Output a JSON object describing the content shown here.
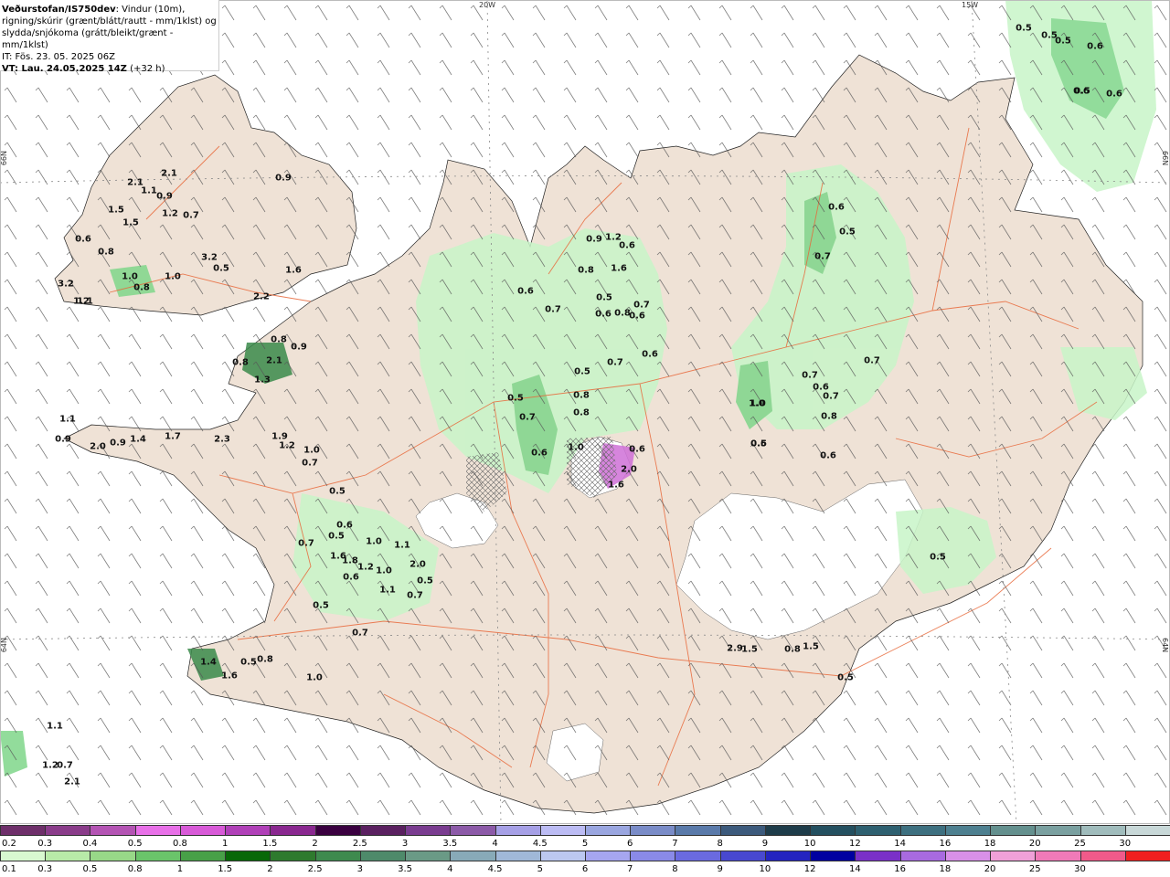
{
  "header": {
    "title": "Veðurstofan/IS750dev",
    "line1": ": Vindur (10m),",
    "line2": "rigning/skúrir (grænt/blátt/rautt - mm/1klst) og",
    "line3": "slydda/snjókoma (grátt/bleikt/grænt - mm/1klst)",
    "it": "IT: Fös. 23. 05. 2025 06Z",
    "vt": "VT: Lau. 24.05.2025 14Z",
    "vt_suffix": " (+32 h)"
  },
  "graticule": {
    "lon_top": [
      "20W",
      "15W"
    ],
    "lat_side": [
      "66N",
      "64N"
    ]
  },
  "colors": {
    "land": "#efe2d6",
    "sea": "#ffffff",
    "roads": "#e8683a",
    "precip_light": "#c8f5c8",
    "precip_mid": "#7fd68a",
    "precip_dark": "#3a8a4a",
    "snow_pink": "#d070d8",
    "glacier": "#ffffff"
  },
  "precip_labels": [
    "0.5",
    "0.5",
    "0.5",
    "0.6",
    "0.5",
    "0.6",
    "0.6",
    "0.9",
    "2.1",
    "2.1",
    "1.1",
    "0.9",
    "1.5",
    "1.2",
    "0.7",
    "1.5",
    "0.6",
    "0.8",
    "3.2",
    "0.5",
    "1.6",
    "1.0",
    "0.8",
    "1.0",
    "3.2",
    "1.2",
    "1.1",
    "2.2",
    "0.8",
    "0.9",
    "0.8",
    "2.1",
    "1.3",
    "1.1",
    "0.9",
    "2.0",
    "0.9",
    "1.4",
    "1.7",
    "2.3",
    "1.9",
    "1.2",
    "1.0",
    "0.7",
    "0.5",
    "0.6",
    "0.5",
    "0.7",
    "1.0",
    "1.1",
    "1.6",
    "1.8",
    "1.2",
    "1.0",
    "0.6",
    "2.0",
    "0.5",
    "1.1",
    "0.7",
    "0.5",
    "0.7",
    "1.4",
    "0.5",
    "0.8",
    "1.6",
    "1.0",
    "1.1",
    "1.2",
    "0.7",
    "2.1",
    "0.9",
    "1.2",
    "0.6",
    "0.8",
    "1.6",
    "0.6",
    "0.7",
    "0.5",
    "0.7",
    "0.6",
    "0.8",
    "0.6",
    "0.6",
    "0.7",
    "0.5",
    "0.8",
    "0.5",
    "0.7",
    "0.8",
    "1.0",
    "0.6",
    "1.0",
    "0.6",
    "2.0",
    "1.6",
    "0.6",
    "0.6",
    "0.5",
    "0.7",
    "0.7",
    "0.6",
    "0.7",
    "0.7",
    "1.0",
    "0.8",
    "0.5",
    "0.6",
    "0.5",
    "2.9",
    "1.5",
    "0.8",
    "1.5",
    "0.5"
  ],
  "legend_snow": {
    "labels": [
      "0.2",
      "0.3",
      "0.4",
      "0.5",
      "0.8",
      "1",
      "1.5",
      "2",
      "2.5",
      "3",
      "3.5",
      "4",
      "4.5",
      "5",
      "6",
      "7",
      "8",
      "9",
      "10",
      "12",
      "14",
      "16",
      "18",
      "20",
      "25",
      "30"
    ],
    "colors": [
      "#6e2f6a",
      "#8a3c8a",
      "#b454b4",
      "#e870e8",
      "#d85ad8",
      "#b040b8",
      "#8a2890",
      "#3a0040",
      "#5a2060",
      "#7a3c90",
      "#8c5aa8",
      "#a6a0e6",
      "#bcbcf4",
      "#9aa6e0",
      "#7a8cc8",
      "#5a7aaa",
      "#3c5a7c",
      "#1e3c4a",
      "#245060",
      "#2e6070",
      "#3e7080",
      "#4e8090",
      "#64908e",
      "#7aa0a0",
      "#a0bcbc",
      "#c8d8d8"
    ]
  },
  "legend_rain": {
    "labels": [
      "0.1",
      "0.3",
      "0.5",
      "0.8",
      "1",
      "1.5",
      "2",
      "2.5",
      "3",
      "3.5",
      "4",
      "4.5",
      "5",
      "6",
      "7",
      "8",
      "9",
      "10",
      "12",
      "14",
      "16",
      "18",
      "20",
      "25",
      "30"
    ],
    "colors": [
      "#d8f8d0",
      "#b8eaa8",
      "#98d888",
      "#6ac46a",
      "#48a048",
      "#086808",
      "#2e7a2e",
      "#3e8a4e",
      "#4e8a6a",
      "#6a9a86",
      "#88aab8",
      "#a0b8d8",
      "#bcc8f0",
      "#a6a6f0",
      "#8a8ae8",
      "#6a6ae0",
      "#4848d0",
      "#2424c0",
      "#0000a0",
      "#7a30c8",
      "#a86ae0",
      "#d890e8",
      "#f0a0d8",
      "#f07ab8",
      "#f05a8a",
      "#f02020"
    ]
  }
}
